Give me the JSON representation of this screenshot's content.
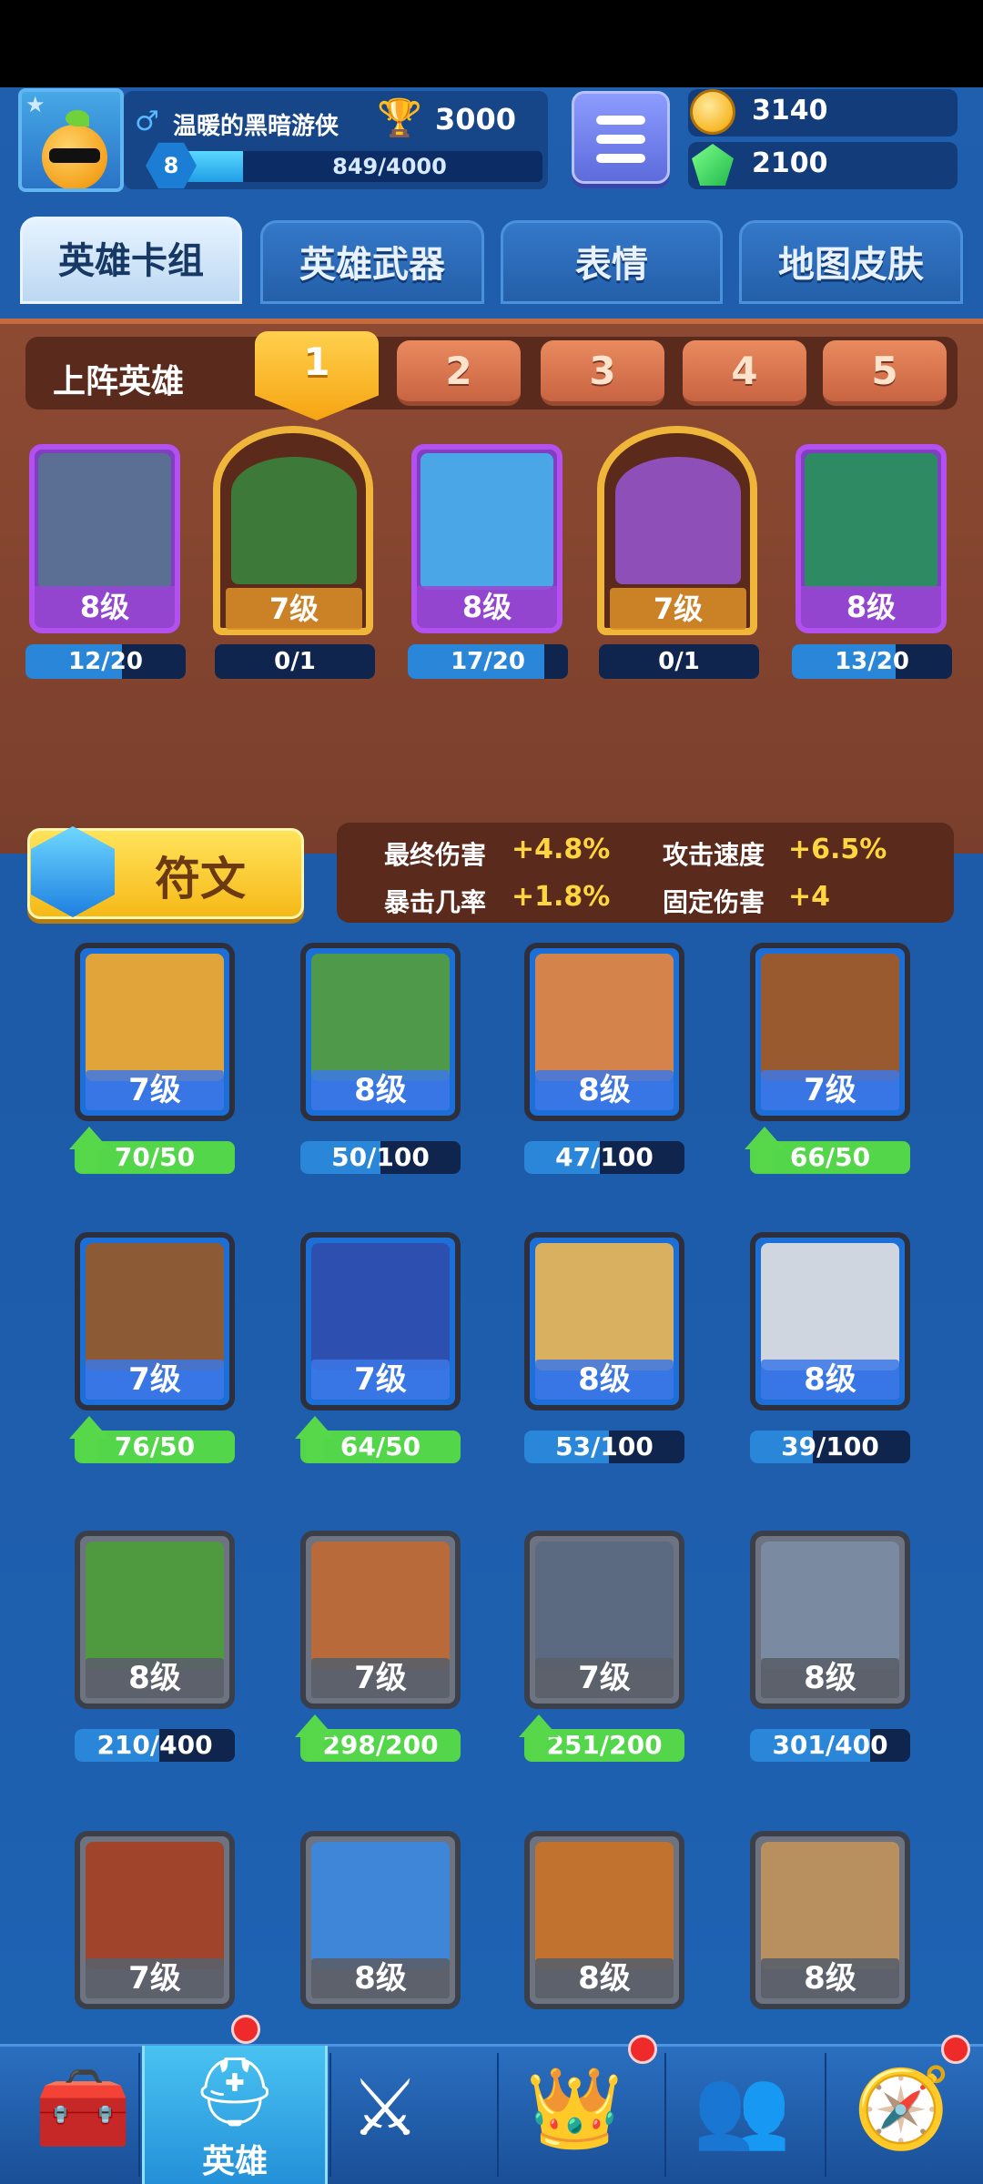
{
  "player": {
    "name": "温暖的黑暗游侠",
    "trophies": "3000",
    "level": "8",
    "xp": "849/4000",
    "xp_fraction": 0.21,
    "gender_icon": "male-icon"
  },
  "resources": {
    "gold": "3140",
    "gems": "2100"
  },
  "tabs": [
    "英雄卡组",
    "英雄武器",
    "表情",
    "地图皮肤"
  ],
  "deck": {
    "label": "上阵英雄",
    "slots": [
      "1",
      "2",
      "3",
      "4",
      "5"
    ],
    "active_slot": 0,
    "cards": [
      {
        "level": "8级",
        "progress": "12/20",
        "fraction": 0.6,
        "style": "purple",
        "art_color": "#5a6f93"
      },
      {
        "level": "7级",
        "progress": "0/1",
        "fraction": 0,
        "style": "gold",
        "art_color": "#3d7a3a"
      },
      {
        "level": "8级",
        "progress": "17/20",
        "fraction": 0.85,
        "style": "purple",
        "art_color": "#4aa6e6"
      },
      {
        "level": "7级",
        "progress": "0/1",
        "fraction": 0,
        "style": "gold",
        "art_color": "#8e4fb8"
      },
      {
        "level": "8级",
        "progress": "13/20",
        "fraction": 0.65,
        "style": "purple",
        "art_color": "#2e8a63"
      }
    ],
    "rune_label": "符文",
    "stats": [
      {
        "name": "最终伤害",
        "value": "+4.8%"
      },
      {
        "name": "攻击速度",
        "value": "+6.5%"
      },
      {
        "name": "暴击几率",
        "value": "+1.8%"
      },
      {
        "name": "固定伤害",
        "value": "+4"
      }
    ]
  },
  "heroes": [
    {
      "level": "7级",
      "progress": "70/50",
      "fraction": 1,
      "upgradable": true,
      "style": "blue",
      "art_color": "#e0a43a"
    },
    {
      "level": "8级",
      "progress": "50/100",
      "fraction": 0.5,
      "upgradable": false,
      "style": "blue",
      "art_color": "#4f9a4a"
    },
    {
      "level": "8级",
      "progress": "47/100",
      "fraction": 0.47,
      "upgradable": false,
      "style": "blue",
      "art_color": "#d4834a"
    },
    {
      "level": "7级",
      "progress": "66/50",
      "fraction": 1,
      "upgradable": true,
      "style": "blue",
      "art_color": "#9a5a30"
    },
    {
      "level": "7级",
      "progress": "76/50",
      "fraction": 1,
      "upgradable": true,
      "style": "blue",
      "art_color": "#8c5a34"
    },
    {
      "level": "7级",
      "progress": "64/50",
      "fraction": 1,
      "upgradable": true,
      "style": "blue",
      "art_color": "#2c4fb0"
    },
    {
      "level": "8级",
      "progress": "53/100",
      "fraction": 0.53,
      "upgradable": false,
      "style": "blue",
      "art_color": "#d8b060"
    },
    {
      "level": "8级",
      "progress": "39/100",
      "fraction": 0.39,
      "upgradable": false,
      "style": "blue",
      "art_color": "#cfd6e0"
    },
    {
      "level": "8级",
      "progress": "210/400",
      "fraction": 0.53,
      "upgradable": false,
      "style": "grey",
      "art_color": "#4f9a3f"
    },
    {
      "level": "7级",
      "progress": "298/200",
      "fraction": 1,
      "upgradable": true,
      "style": "grey",
      "art_color": "#b86a3a"
    },
    {
      "level": "7级",
      "progress": "251/200",
      "fraction": 1,
      "upgradable": true,
      "style": "grey",
      "art_color": "#5b6a80"
    },
    {
      "level": "8级",
      "progress": "301/400",
      "fraction": 0.75,
      "upgradable": false,
      "style": "grey",
      "art_color": "#7a8aa0"
    },
    {
      "level": "7级",
      "progress": "",
      "fraction": 0,
      "upgradable": false,
      "style": "grey",
      "art_color": "#a0452c"
    },
    {
      "level": "8级",
      "progress": "",
      "fraction": 0,
      "upgradable": false,
      "style": "grey",
      "art_color": "#3f86d8"
    },
    {
      "level": "8级",
      "progress": "",
      "fraction": 0,
      "upgradable": false,
      "style": "grey",
      "art_color": "#c0722e"
    },
    {
      "level": "8级",
      "progress": "",
      "fraction": 0,
      "upgradable": false,
      "style": "grey",
      "art_color": "#b89060"
    }
  ],
  "nav": [
    {
      "icon": "treasure-chest-icon",
      "label": "",
      "badge": false
    },
    {
      "icon": "knight-helmet-icon",
      "label": "英雄",
      "badge": true
    },
    {
      "icon": "crossed-swords-icon",
      "label": "",
      "badge": false
    },
    {
      "icon": "crown-shield-icon",
      "label": "",
      "badge": true
    },
    {
      "icon": "team-banner-icon",
      "label": "",
      "badge": false
    },
    {
      "icon": "compass-icon",
      "label": "",
      "badge": true
    }
  ],
  "colors": {
    "accent_gold": "#ffd540",
    "upgrade_green": "#54d64a",
    "panel_brown": "#7a3f2c"
  }
}
